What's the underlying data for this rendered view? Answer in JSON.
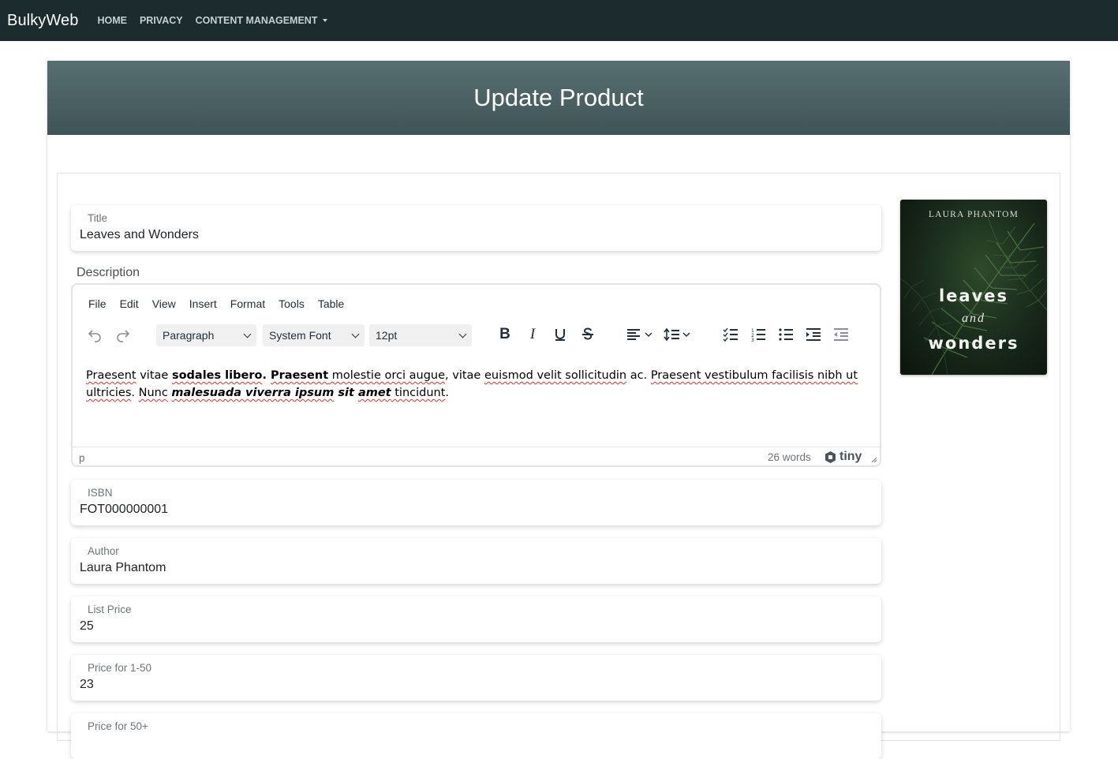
{
  "navbar": {
    "brand": "BulkyWeb",
    "links": [
      "HOME",
      "PRIVACY",
      "CONTENT MANAGEMENT"
    ]
  },
  "page": {
    "title": "Update Product"
  },
  "form": {
    "title": {
      "label": "Title",
      "value": "Leaves and Wonders"
    },
    "description_label": "Description",
    "isbn": {
      "label": "ISBN",
      "value": "FOT000000001"
    },
    "author": {
      "label": "Author",
      "value": "Laura Phantom"
    },
    "list_price": {
      "label": "List Price",
      "value": "25"
    },
    "price_1_50": {
      "label": "Price for 1-50",
      "value": "23"
    },
    "price_50_plus": {
      "label": "Price for 50+"
    }
  },
  "editor": {
    "menu": [
      "File",
      "Edit",
      "View",
      "Insert",
      "Format",
      "Tools",
      "Table"
    ],
    "block_format": "Paragraph",
    "font_family": "System Font",
    "font_size": "12pt",
    "content": {
      "p1": "Praesent",
      "p2": " vitae ",
      "p3": "sodales libero",
      "p4": ". ",
      "p5": "Praesent",
      "p6": " molestie orci augue",
      "p7": ", vitae ",
      "p8": "euismod velit",
      "p9": " sollicitudin",
      "p10": " ac. ",
      "p11": "Praesent vestibulum facilisis nibh ut ultricies",
      "p12": ". ",
      "p13": "Nunc",
      "p14": " ",
      "p15": "malesuada viverra ipsum",
      "p16": " sit ",
      "p17": "amet",
      "p18": " tincidunt",
      "p19": "."
    },
    "status_path": "p",
    "word_count": "26 words",
    "brand": "tiny"
  },
  "cover": {
    "author": "LAURA PHANTOM",
    "title_top": "leaves",
    "title_mid": "and",
    "title_bottom": "wonders"
  },
  "colors": {
    "navbar_bg": "#1c2b2d",
    "header_bg": "#4c6264"
  }
}
